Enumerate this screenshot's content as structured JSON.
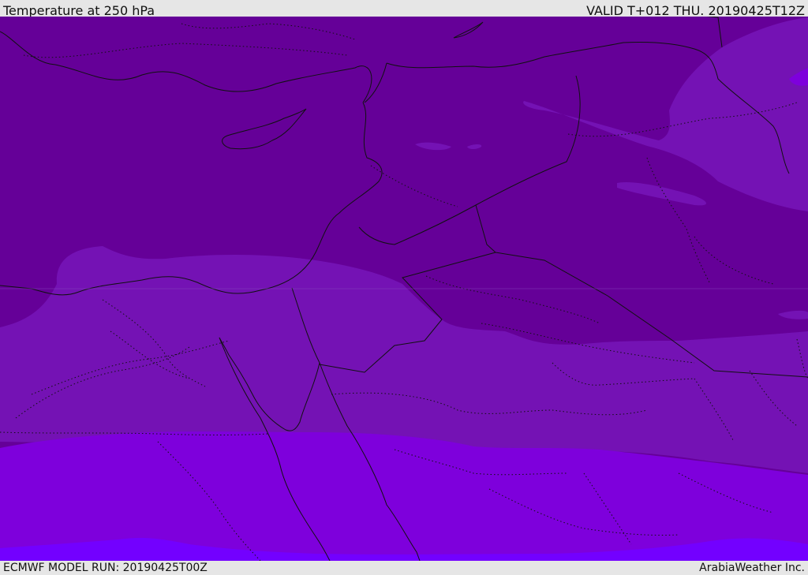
{
  "header": {
    "title": "Temperature at 250 hPa",
    "valid": "VALID T+012 THU. 20190425T12Z"
  },
  "footer": {
    "model_run": "ECMWF MODEL RUN: 20190425T00Z",
    "credit": "ArabiaWeather Inc."
  },
  "map": {
    "colors": {
      "coldest": "#650098",
      "cold": "#7412b4",
      "mild": "#7e00dc",
      "warm": "#7300ff",
      "border": "#111111"
    }
  }
}
